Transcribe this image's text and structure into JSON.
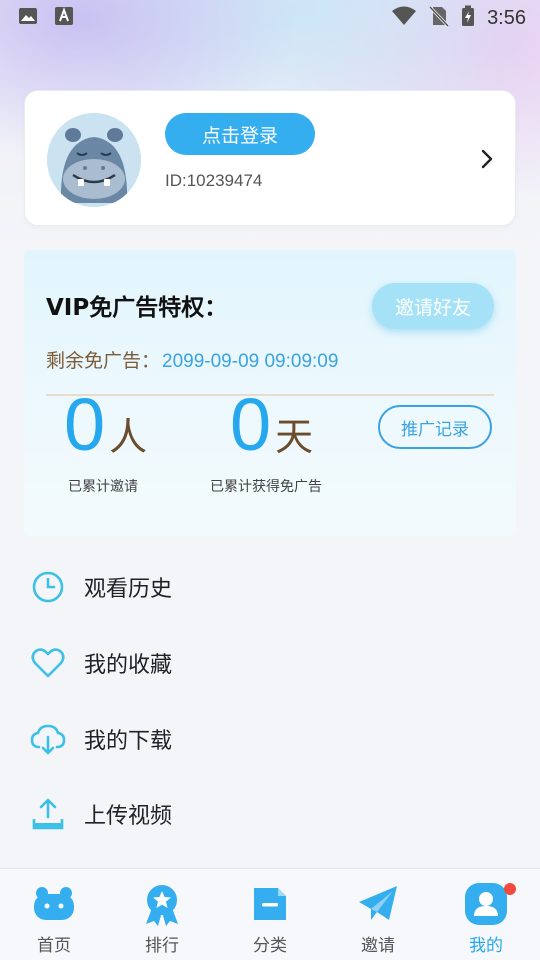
{
  "status_bar": {
    "time": "3:56",
    "icons": [
      "image-icon",
      "text-a-icon",
      "wifi-icon",
      "no-sim-icon",
      "battery-charging-icon"
    ]
  },
  "profile": {
    "login_label": "点击登录",
    "user_id": "ID:10239474",
    "avatar_icon": "hippo-avatar-icon"
  },
  "vip": {
    "title": "VIP免广告特权：",
    "invite_label": "邀请好友",
    "ad_free_label": "剩余免广告：",
    "ad_free_until": "2099-09-09 09:09:09",
    "invited_count": "0",
    "invited_unit": "人",
    "invited_caption": "已累计邀请",
    "days_count": "0",
    "days_unit": "天",
    "days_caption": "已累计获得免广告",
    "records_label": "推广记录"
  },
  "menu": {
    "items": [
      {
        "label": "观看历史",
        "icon": "clock-icon"
      },
      {
        "label": "我的收藏",
        "icon": "heart-icon"
      },
      {
        "label": "我的下载",
        "icon": "cloud-download-icon"
      },
      {
        "label": "上传视频",
        "icon": "upload-icon"
      }
    ]
  },
  "nav": {
    "items": [
      {
        "label": "首页",
        "icon": "home-icon",
        "active": false
      },
      {
        "label": "排行",
        "icon": "ranking-badge-icon",
        "active": false
      },
      {
        "label": "分类",
        "icon": "category-icon",
        "active": false
      },
      {
        "label": "邀请",
        "icon": "send-icon",
        "active": false
      },
      {
        "label": "我的",
        "icon": "user-icon",
        "active": true
      }
    ]
  },
  "colors": {
    "accent": "#26a8ee",
    "button_blue": "#35aef0",
    "invite_button": "#a5e2f8",
    "brown_text": "#7a5b3a",
    "badge_red": "#f04b3c"
  }
}
